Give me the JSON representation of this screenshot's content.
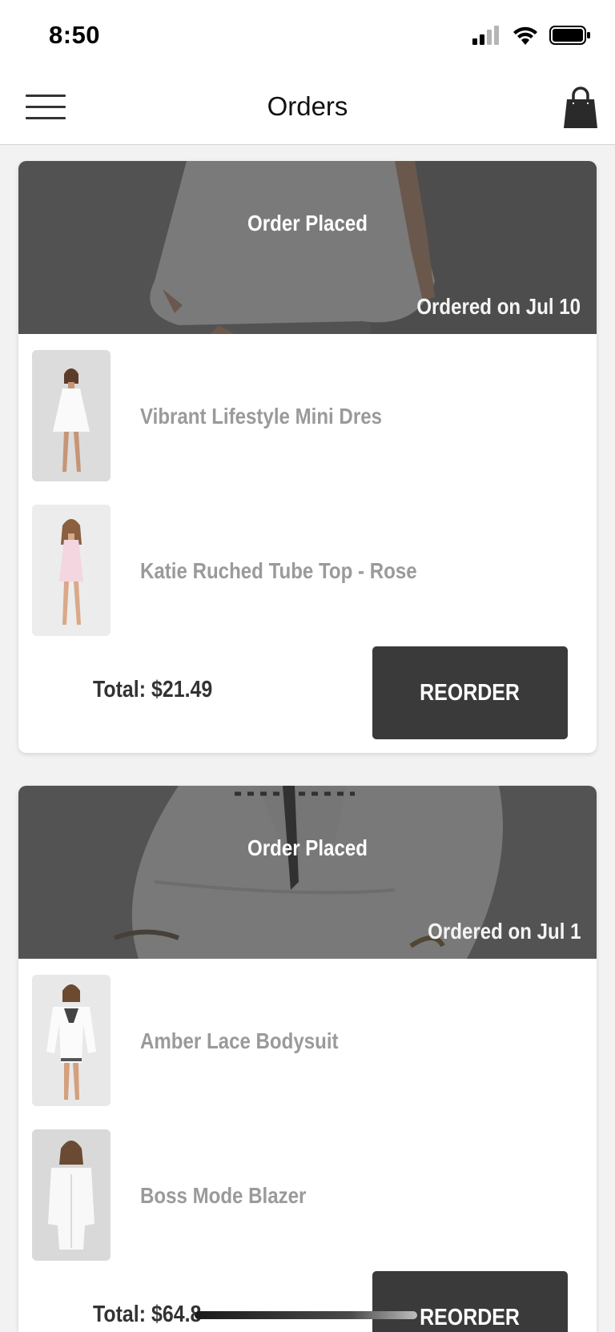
{
  "status_bar": {
    "time": "8:50",
    "icons": [
      "cellular-signal-icon",
      "wifi-icon",
      "battery-icon"
    ]
  },
  "nav": {
    "title": "Orders",
    "left_icon": "hamburger-menu-icon",
    "right_icon": "shopping-bag-icon"
  },
  "orders": [
    {
      "status": "Order Placed",
      "date": "Ordered on Jul 10",
      "items": [
        {
          "name": "Vibrant Lifestyle Mini Dres"
        },
        {
          "name": "Katie Ruched Tube Top - Rose"
        }
      ],
      "total": "Total: $21.49",
      "button": "REORDER"
    },
    {
      "status": "Order Placed",
      "date": "Ordered on Jul 1",
      "items": [
        {
          "name": "Amber Lace Bodysuit"
        },
        {
          "name": "Boss Mode Blazer"
        }
      ],
      "total": "Total: $64.8",
      "button": "REORDER"
    }
  ],
  "colors": {
    "header_overlay": "#303030",
    "button_bg": "#3a3a3a",
    "item_name": "#9a9a9a"
  }
}
